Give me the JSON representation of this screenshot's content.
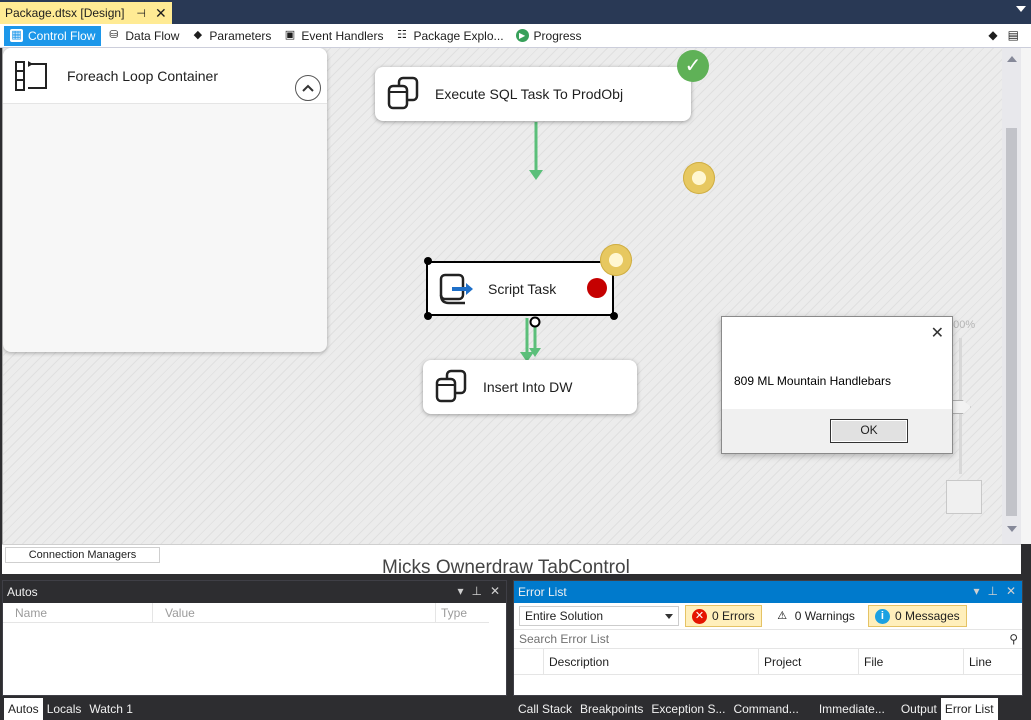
{
  "document_tab": {
    "title": "Package.dtsx [Design]",
    "pin": "⊣",
    "close": "✕"
  },
  "designer_tabs": [
    {
      "label": "Control Flow",
      "icon": "control-flow-icon"
    },
    {
      "label": "Data Flow",
      "icon": "data-flow-icon"
    },
    {
      "label": "Parameters",
      "icon": "parameters-icon"
    },
    {
      "label": "Event Handlers",
      "icon": "event-handlers-icon"
    },
    {
      "label": "Package Explo...",
      "icon": "package-explorer-icon"
    },
    {
      "label": "Progress",
      "icon": "progress-icon"
    }
  ],
  "canvas": {
    "execute_sql_task": {
      "label": "Execute SQL Task To ProdObj",
      "status": "success"
    },
    "foreach_container": {
      "label": "Foreach Loop Container",
      "status": "running"
    },
    "script_task": {
      "label": "Script Task",
      "status": "running",
      "breakpoint": true
    },
    "insert_task": {
      "label": "Insert Into DW"
    },
    "zoom": "100%"
  },
  "message_box": {
    "text": "809 ML Mountain Handlebars",
    "ok_label": "OK",
    "close": "✕"
  },
  "connection_managers": {
    "tab_label": "Connection Managers",
    "ghost_text": "Micks Ownerdraw TabControl"
  },
  "autos_panel": {
    "title": "Autos",
    "columns": [
      "Name",
      "Value",
      "Type"
    ],
    "tabs": [
      "Autos",
      "Locals",
      "Watch 1"
    ],
    "active_tab": "Autos"
  },
  "error_list": {
    "title": "Error List",
    "scope": "Entire Solution",
    "errors_label": "0 Errors",
    "warnings_label": "0 Warnings",
    "messages_label": "0 Messages",
    "search_placeholder": "Search Error List",
    "columns": [
      "Description",
      "Project",
      "File",
      "Line"
    ]
  },
  "bottom_right_tabs": [
    "Call Stack",
    "Breakpoints",
    "Exception S...",
    "Command...",
    "Immediate...",
    "Output",
    "Error List"
  ],
  "colors": {
    "doc_tab": "#ffeb94",
    "active_designer_tab": "#1c97ea",
    "success": "#5fb157",
    "connector": "#5bbf7a",
    "breakpoint": "#c50000",
    "chrome_dark": "#2d2d30"
  }
}
